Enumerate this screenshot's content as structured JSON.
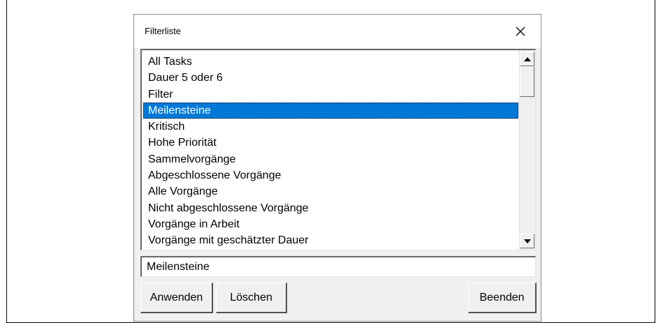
{
  "dialog": {
    "title": "Filterliste",
    "close_icon": "close-icon"
  },
  "list": {
    "items": [
      "All Tasks",
      "Dauer 5 oder 6",
      "Filter",
      "Meilensteine",
      "Kritisch",
      "Hohe Priorität",
      "Sammelvorgänge",
      "Abgeschlossene Vorgänge",
      "Alle Vorgänge",
      "Nicht abgeschlossene Vorgänge",
      "Vorgänge in Arbeit",
      "Vorgänge mit geschätzter Dauer"
    ],
    "selected": "Meilensteine",
    "selection_color": "#0078d7"
  },
  "field": {
    "value": "Meilensteine"
  },
  "buttons": {
    "apply": "Anwenden",
    "delete": "Löschen",
    "exit": "Beenden"
  }
}
